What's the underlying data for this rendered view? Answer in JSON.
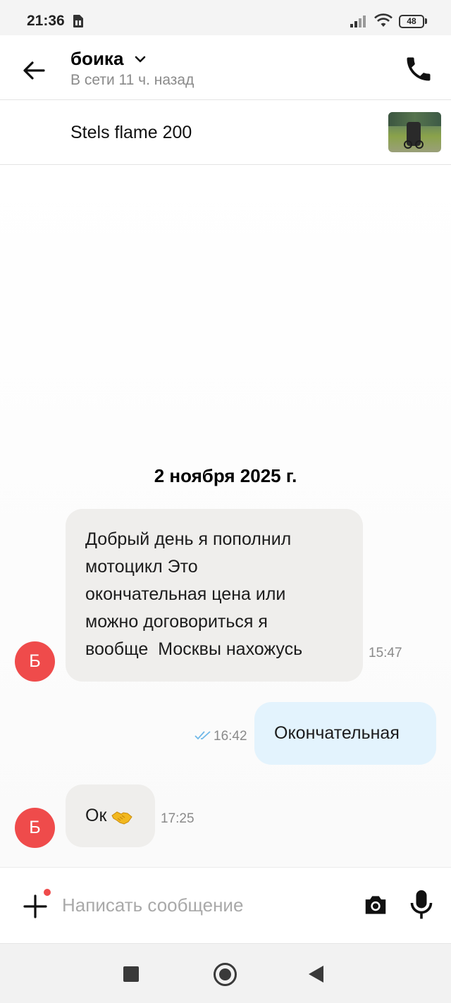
{
  "status_bar": {
    "time": "21:36",
    "battery": "48",
    "icons": [
      "sim-card-icon",
      "signal-icon",
      "wifi-icon",
      "battery-icon"
    ]
  },
  "header": {
    "contact_name": "боика",
    "status": "В сети 11 ч. назад",
    "icons": [
      "back-arrow-icon",
      "chevron-down-icon",
      "phone-icon"
    ]
  },
  "listing": {
    "title": "Stels flame 200"
  },
  "chat": {
    "date": "2 ноября 2025 г.",
    "messages": [
      {
        "direction": "incoming",
        "avatar": "Б",
        "lines": [
          "Добрый день я пополнил",
          "мотоцикл Это",
          "окончательная цена или",
          "можно договориться я",
          "вообще  Москвы нахожусь"
        ],
        "time": "15:47"
      },
      {
        "direction": "outgoing",
        "text": "Окончательная",
        "time": "16:42",
        "read": true
      },
      {
        "direction": "incoming",
        "avatar": "Б",
        "text": "Ок",
        "emoji": "handshake-icon",
        "time": "17:25"
      }
    ]
  },
  "input_bar": {
    "placeholder": "Написать сообщение",
    "value": "",
    "icons": [
      "plus-icon",
      "camera-icon",
      "microphone-icon"
    ]
  },
  "nav_bar": {
    "icons": [
      "recent-apps-icon",
      "home-icon",
      "back-icon"
    ]
  },
  "colors": {
    "accent_red": "#ef4b4b",
    "incoming_bubble": "#efeeec",
    "outgoing_bubble": "#e3f3fd",
    "read_ticks": "#6fb8e8",
    "muted_text": "#8a8a8a"
  }
}
